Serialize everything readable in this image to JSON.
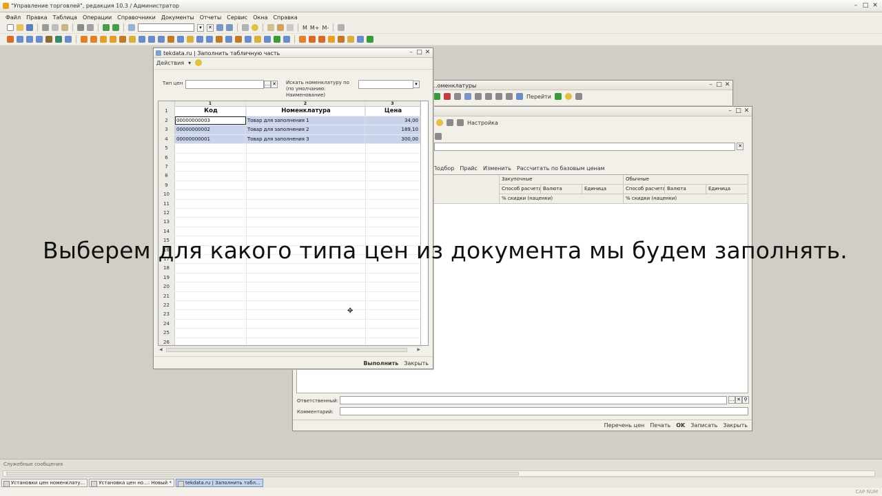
{
  "app": {
    "title": "\"Управление торговлей\", редакция 10.3 / Администратор",
    "menu": [
      "Файл",
      "Правка",
      "Таблица",
      "Операции",
      "Справочники",
      "Документы",
      "Отчеты",
      "Сервис",
      "Окна",
      "Справка"
    ],
    "toolbar_labels": [
      "M",
      "M+",
      "M-"
    ]
  },
  "dialog": {
    "title": "tekdata.ru | Заполнить табличную часть",
    "actions_menu": "Действия",
    "price_type_label": "Тип цен",
    "price_type_value": "",
    "search_label": "Искать номенклатуру по (по умолчанию: Наименование)",
    "search_value": "",
    "columns": [
      {
        "num": "1",
        "name": "Код"
      },
      {
        "num": "2",
        "name": "Номенклатура"
      },
      {
        "num": "3",
        "name": "Цена"
      }
    ],
    "rows": [
      {
        "n": "2",
        "code": "00000000003",
        "name": "Товар для заполнения 1",
        "price": "34,00"
      },
      {
        "n": "3",
        "code": "00000000002",
        "name": "Товар для заполнения 2",
        "price": "189,10"
      },
      {
        "n": "4",
        "code": "00000000001",
        "name": "Товар для заполнения 3",
        "price": "300,00"
      }
    ],
    "row_numbers_first": "1",
    "empty_rows": [
      "5",
      "6",
      "7",
      "8",
      "9",
      "10",
      "11",
      "12",
      "13",
      "14",
      "15",
      "16",
      "17",
      "18",
      "19",
      "20",
      "21",
      "22",
      "23",
      "24",
      "25",
      "26"
    ],
    "fill_button": "Выполнить",
    "close_button": "Закрыть"
  },
  "back_window": {
    "title": "...оменклатуры",
    "goto": "Перейти"
  },
  "doc_window": {
    "settings": "Настройка",
    "grid_toolbar": [
      "Подбор",
      "Прайс",
      "Изменить",
      "Рассчитать по базовым ценам"
    ],
    "group_headers": [
      "Закупочные",
      "Обычные"
    ],
    "sub_headers": [
      "Способ расчета",
      "Валюта",
      "Единица",
      "Способ расчета",
      "Валюта",
      "Единица"
    ],
    "discount_headers": [
      "% скидки (наценки)",
      "% скидки (наценки)"
    ],
    "responsible_label": "Ответственный:",
    "comment_label": "Комментарий:",
    "bottom_buttons": [
      "Перечень цен",
      "Печать",
      "OK",
      "Записать",
      "Закрыть"
    ]
  },
  "messages_panel": "Служебные сообщения",
  "taskbar": [
    {
      "label": "Установки цен номенклату..."
    },
    {
      "label": "Установка цен но...: Новый *"
    },
    {
      "label": "tekdata.ru | Заполнить табл..."
    }
  ],
  "status": "CAP NUM",
  "subtitle": "Выберем для какого типа цен из документа мы будем заполнять."
}
